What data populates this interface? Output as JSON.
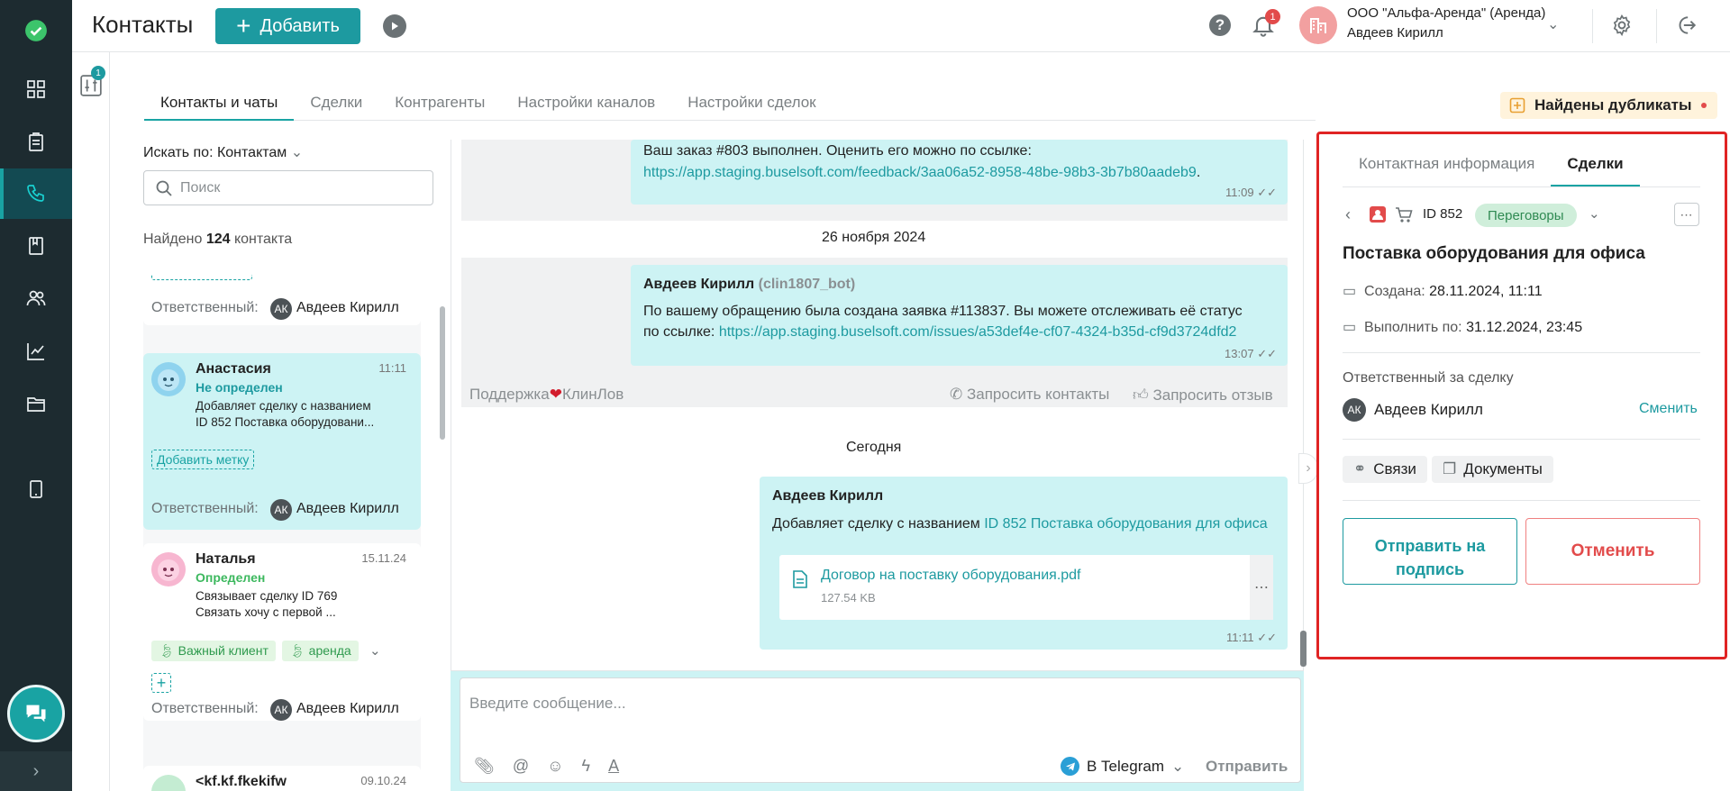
{
  "header": {
    "title": "Контакты",
    "add_label": "Добавить",
    "notifications_count": "1",
    "company": "ООО \"Альфа-Аренда\" (Аренда)",
    "user": "Авдеев Кирилл"
  },
  "subrail": {
    "filter_badge": "1"
  },
  "tabs": [
    "Контакты и чаты",
    "Сделки",
    "Контрагенты",
    "Настройки каналов",
    "Настройки сделок"
  ],
  "duplicates_label": "Найдены дубликаты",
  "contacts": {
    "search_by": "Искать по: Контактам",
    "search_placeholder": "Поиск",
    "found_prefix": "Найдено",
    "found_count": "124",
    "found_suffix": "контакта",
    "responsible_label": "Ответственный:",
    "responsible_initials": "АК",
    "responsible_name": "Авдеев Кирилл",
    "add_tag_label": "Добавить метку",
    "items": [
      {
        "name": "Анастасия",
        "time": "11:11",
        "status": "Не определен",
        "line1": "Добавляет сделку с названием",
        "line2": "ID 852 Поставка оборудовани..."
      },
      {
        "name": "Наталья",
        "time": "15.11.24",
        "status": "Определен",
        "line1": "Связывает сделку ID 769",
        "line2": "Связать хочу с первой ...",
        "tags": [
          "Важный клиент",
          "аренда"
        ]
      },
      {
        "name": "<kf.kf.fkekifw",
        "time": "09.10.24"
      }
    ]
  },
  "chat": {
    "msg1_text": "Ваш заказ #803 выполнен. Оценить его можно по ссылке:",
    "msg1_link": "https://app.staging.buselsoft.com/feedback/3aa06a52-8958-48be-98b3-3b7b80aadeb9",
    "msg1_link_suffix": ".",
    "msg1_time": "11:09",
    "date1": "26 ноября 2024",
    "msg2_author": "Авдеев Кирилл",
    "msg2_bot": "(clin1807_bot)",
    "msg2_line1": "По вашему обращению была создана заявка #113837. Вы можете отслеживать её статус",
    "msg2_line2_prefix": "по ссылке:",
    "msg2_link": "https://app.staging.buselsoft.com/issues/a53def4e-cf07-4324-b35d-cf9d3724dfd2",
    "msg2_time": "13:07",
    "support_left": "Поддержка",
    "support_right": "КлинЛов",
    "request_contacts": "Запросить контакты",
    "request_review": "Запросить отзыв",
    "date2": "Сегодня",
    "msg3_author": "Авдеев Кирилл",
    "msg3_prefix": "Добавляет сделку с названием",
    "msg3_link": "ID 852 Поставка оборудования для офиса",
    "file_name": "Договор на поставку оборудования.pdf",
    "file_size": "127.54 KB",
    "msg3_time": "11:11",
    "input_placeholder": "Введите сообщение...",
    "channel": "В Telegram",
    "send_label": "Отправить"
  },
  "deal_panel": {
    "tabs": [
      "Контактная информация",
      "Сделки"
    ],
    "deal_id": "ID 852",
    "stage": "Переговоры",
    "title": "Поставка оборудования для офиса",
    "created_label": "Создана:",
    "created_value": "28.11.2024, 11:11",
    "due_label": "Выполнить по:",
    "due_value": "31.12.2024, 23:45",
    "responsible_title": "Ответственный за сделку",
    "responsible_initials": "АК",
    "responsible_name": "Авдеев Кирилл",
    "change_label": "Сменить",
    "links_label": "Связи",
    "docs_label": "Документы",
    "sign_label": "Отправить на подпись",
    "cancel_label": "Отменить"
  },
  "colors": {
    "accent": "#1d9aa0",
    "selected_bg": "#cdf3f4",
    "danger": "#e24b4b",
    "rail": "#1d2b30"
  }
}
